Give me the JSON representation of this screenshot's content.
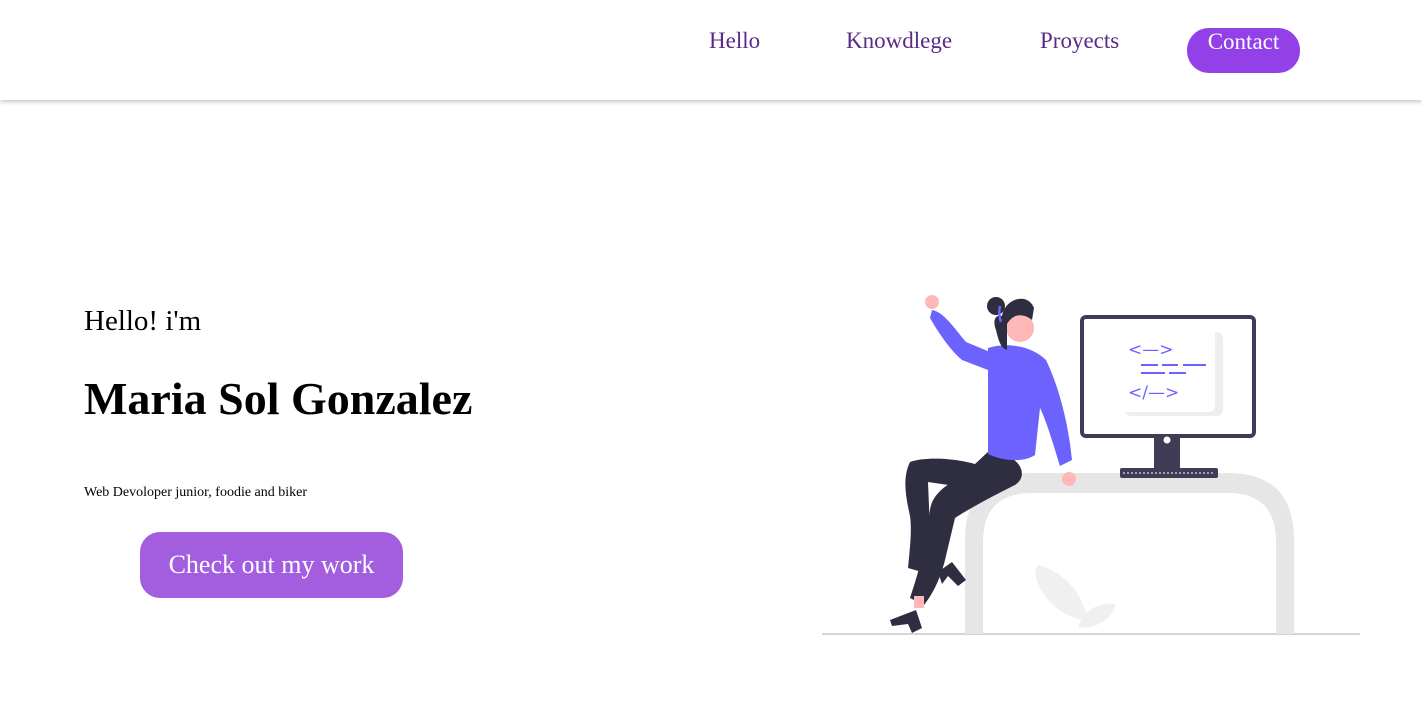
{
  "nav": {
    "items": [
      {
        "label": "Hello"
      },
      {
        "label": "Knowdlege"
      },
      {
        "label": "Proyects"
      }
    ],
    "contact_label": "Contact"
  },
  "hero": {
    "greeting": "Hello! i'm",
    "name": "Maria Sol Gonzalez",
    "tagline": "Web Devoloper junior, foodie and biker",
    "cta_label": "Check out my work"
  },
  "illustration": {
    "icon": "developer-at-desk-illustration",
    "accent_color": "#6c63ff",
    "code_lines": [
      "<—>",
      "</—>"
    ]
  },
  "colors": {
    "nav_text": "#5b2a86",
    "contact_bg": "#9340e8",
    "cta_bg": "#a35ee0"
  }
}
